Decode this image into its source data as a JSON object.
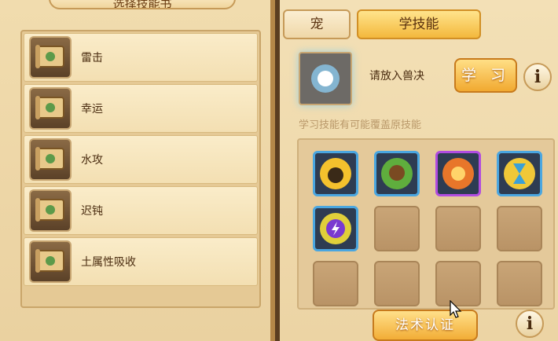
{
  "left": {
    "title": "选择技能书",
    "books": [
      {
        "label": "雷击"
      },
      {
        "label": "幸运"
      },
      {
        "label": "水攻"
      },
      {
        "label": "迟钝"
      },
      {
        "label": "土属性吸收"
      }
    ]
  },
  "right": {
    "tabs": [
      {
        "label": "宠"
      },
      {
        "label": "学技能"
      }
    ],
    "prompt": "请放入兽决",
    "learn_button": "学 习",
    "info_glyph": "i",
    "hint": "学习技能有可能覆盖原技能",
    "skills": [
      {
        "icon": "thunder-skill-icon"
      },
      {
        "icon": "bird-strike-skill-icon"
      },
      {
        "icon": "fire-burst-skill-icon"
      },
      {
        "icon": "hourglass-skill-icon"
      },
      {
        "icon": "purple-bolt-skill-icon"
      }
    ],
    "cert_button": "法术认证"
  }
}
